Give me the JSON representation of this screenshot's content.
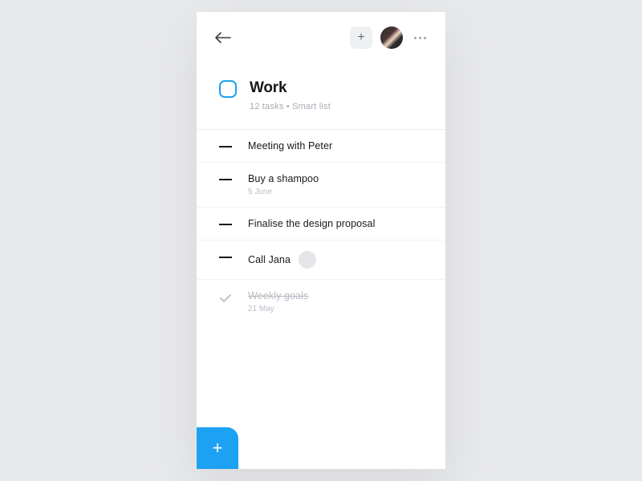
{
  "header": {
    "title": "Work",
    "meta": "12 tasks   •   Smart list"
  },
  "tasks": [
    {
      "title": "Meeting with Peter",
      "sub": "",
      "completed": false,
      "hasAssignee": false
    },
    {
      "title": "Buy a shampoo",
      "sub": "5 June",
      "completed": false,
      "hasAssignee": false
    },
    {
      "title": "Finalise the design proposal",
      "sub": "",
      "completed": false,
      "hasAssignee": false
    },
    {
      "title": "Call Jana",
      "sub": "",
      "completed": false,
      "hasAssignee": true
    },
    {
      "title": "Weekly goals",
      "sub": "21 May",
      "completed": true,
      "hasAssignee": false
    }
  ]
}
